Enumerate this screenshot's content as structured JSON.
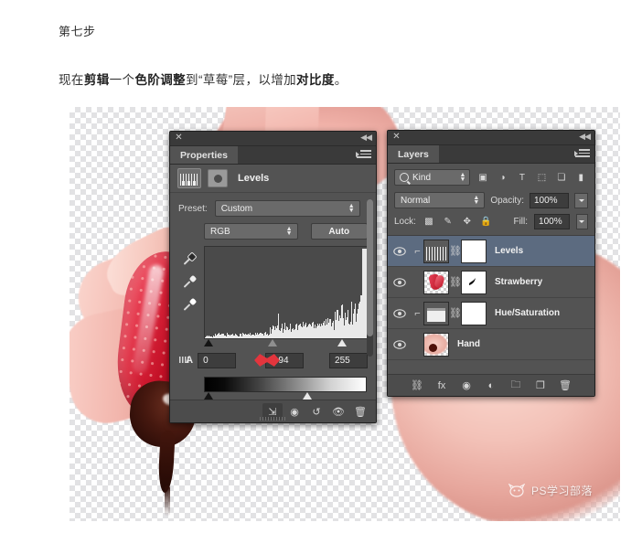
{
  "article": {
    "step_title": "第七步",
    "body_prefix": "现在",
    "body_b1": "剪辑",
    "body_mid1": "一个",
    "body_b2": "色阶调整",
    "body_mid2": "到“草莓”层，以增加",
    "body_b3": "对比度",
    "body_suffix": "。"
  },
  "properties_panel": {
    "close_icon": "✕",
    "collapse_icon": "◀◀",
    "tab_label": "Properties",
    "adjustment_title": "Levels",
    "histogram_icon": "levels-histogram-icon",
    "mask_icon": "layer-mask-icon",
    "preset_label": "Preset:",
    "preset_value": "Custom",
    "channel_value": "RGB",
    "auto_label": "Auto",
    "input_black": "0",
    "input_gamma": "0.94",
    "input_white": "255",
    "footer_buttons": [
      {
        "name": "clip-to-layer-button",
        "glyph": "⇲"
      },
      {
        "name": "view-previous-state-button",
        "glyph": "◉"
      },
      {
        "name": "reset-button",
        "glyph": "↺"
      },
      {
        "name": "toggle-visibility-button",
        "glyph": "👁"
      },
      {
        "name": "delete-adjustment-button",
        "glyph": "🗑"
      }
    ]
  },
  "layers_panel": {
    "close_icon": "✕",
    "collapse_icon": "◀◀",
    "tab_label": "Layers",
    "filter_kind": "Kind",
    "filter_icons": [
      {
        "name": "filter-pixel-layers-icon",
        "glyph": "▣"
      },
      {
        "name": "filter-adjustment-layers-icon",
        "glyph": "◑"
      },
      {
        "name": "filter-type-layers-icon",
        "glyph": "T"
      },
      {
        "name": "filter-shape-layers-icon",
        "glyph": "⬚"
      },
      {
        "name": "filter-smart-object-icon",
        "glyph": "❏"
      },
      {
        "name": "filter-toggle-icon",
        "glyph": "▮"
      }
    ],
    "blend_mode": "Normal",
    "opacity_label": "Opacity:",
    "opacity_value": "100%",
    "lock_label": "Lock:",
    "lock_icons": [
      {
        "name": "lock-transparent-pixels-icon",
        "glyph": "▩"
      },
      {
        "name": "lock-image-pixels-icon",
        "glyph": "✎"
      },
      {
        "name": "lock-position-icon",
        "glyph": "✥"
      },
      {
        "name": "lock-all-icon",
        "glyph": "🔒"
      }
    ],
    "fill_label": "Fill:",
    "fill_value": "100%",
    "layers": [
      {
        "name": "Levels",
        "selected": true,
        "clipped": true,
        "has_mask": true,
        "thumb": "levels"
      },
      {
        "name": "Strawberry",
        "selected": false,
        "clipped": false,
        "has_mask": true,
        "thumb": "strawberry"
      },
      {
        "name": "Hue/Saturation",
        "selected": false,
        "clipped": true,
        "has_mask": true,
        "thumb": "huesat"
      },
      {
        "name": "Hand",
        "selected": false,
        "clipped": false,
        "has_mask": false,
        "thumb": "hand"
      }
    ],
    "footer_buttons": [
      {
        "name": "link-layers-button",
        "glyph": "⛓"
      },
      {
        "name": "layer-style-button",
        "glyph": "fx"
      },
      {
        "name": "add-layer-mask-button",
        "glyph": "◉"
      },
      {
        "name": "new-adjustment-layer-button",
        "glyph": "◐"
      },
      {
        "name": "new-group-button",
        "glyph": "🗀"
      },
      {
        "name": "new-layer-button",
        "glyph": "❐"
      },
      {
        "name": "delete-layer-button",
        "glyph": "🗑"
      }
    ]
  },
  "watermark": {
    "text": "PS学习部落",
    "logo": "cat-logo-icon"
  },
  "colors": {
    "panel_bg": "#535353",
    "panel_header": "#3a3a3a",
    "selected_layer": "#5c6b80",
    "cursor_red": "#e3353d"
  }
}
